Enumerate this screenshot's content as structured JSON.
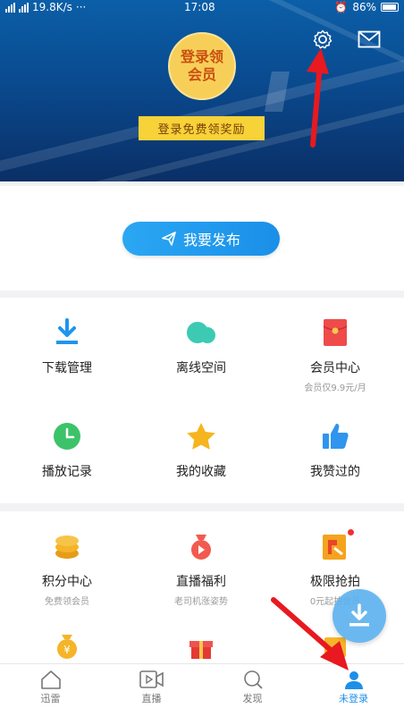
{
  "status_bar": {
    "speed": "19.8K/s",
    "dots": "···",
    "time": "17:08",
    "battery": "86%"
  },
  "header": {
    "vip_badge_line1": "登录领",
    "vip_badge_line2": "会员",
    "login_banner": "登录免费领奖励"
  },
  "publish": {
    "label": "我要发布"
  },
  "grid1": {
    "items": [
      {
        "label": "下载管理",
        "icon": "download-icon",
        "color": "#1e95ee"
      },
      {
        "label": "离线空间",
        "icon": "cloud-icon",
        "color": "#3ccab3"
      },
      {
        "label": "会员中心",
        "sub": "会员仅9.9元/月",
        "icon": "red-envelope-icon",
        "color": "#ef4b4b"
      },
      {
        "label": "播放记录",
        "icon": "clock-icon",
        "color": "#3cc36a"
      },
      {
        "label": "我的收藏",
        "icon": "star-icon",
        "color": "#f6b51e"
      },
      {
        "label": "我赞过的",
        "icon": "thumbs-up-icon",
        "color": "#2f95ee"
      }
    ]
  },
  "grid2": {
    "items": [
      {
        "label": "积分中心",
        "sub": "免费领会员",
        "icon": "coins-icon",
        "color": "#f5b429"
      },
      {
        "label": "直播福利",
        "sub": "老司机涨姿势",
        "icon": "money-bag-icon",
        "color": "#f25a4f"
      },
      {
        "label": "极限抢拍",
        "sub": "0元起拍会员",
        "icon": "auction-icon",
        "color": "#f5a31e"
      },
      {
        "icon": "yuan-bag-icon",
        "color": "#f5b429"
      },
      {
        "icon": "gift-icon",
        "color": "#ef5350"
      },
      {
        "icon": "ticket-icon",
        "color": "#f5b429"
      }
    ]
  },
  "nav": {
    "items": [
      {
        "label": "迅雷",
        "icon": "home-icon"
      },
      {
        "label": "直播",
        "icon": "video-icon"
      },
      {
        "label": "发现",
        "icon": "search-icon"
      },
      {
        "label": "未登录",
        "icon": "user-icon"
      }
    ]
  },
  "colors": {
    "accent": "#1e8fe8",
    "header_top": "#0b5fa8",
    "header_bottom": "#0a2f66",
    "annotation_red": "#e8191f"
  }
}
